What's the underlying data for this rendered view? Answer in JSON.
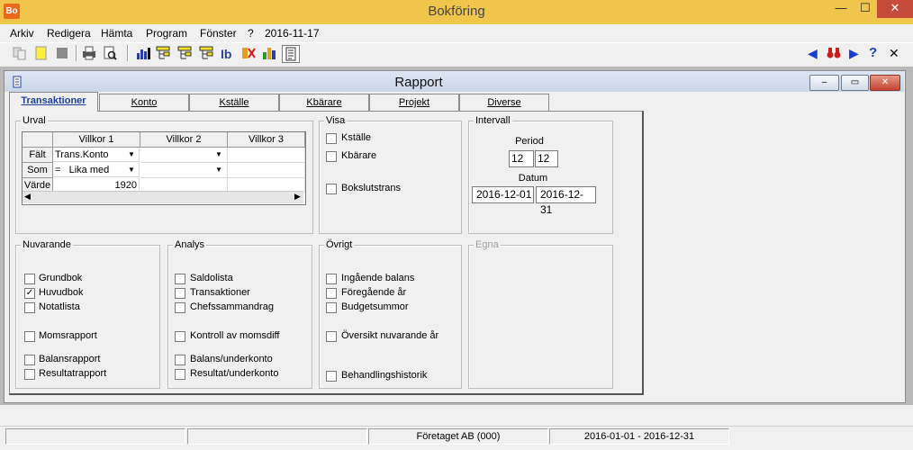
{
  "app": {
    "title": "Bokföring",
    "icon_text": "Bo"
  },
  "window_buttons": {
    "minimize": "—",
    "maximize": "☐",
    "close": "✕"
  },
  "menu": [
    "Arkiv",
    "Redigera",
    "Hämta",
    "Program",
    "Fönster",
    "?",
    "2016-11-17"
  ],
  "toolbar_icons": [
    "copy-icon",
    "new-icon",
    "stop-icon",
    "print-icon",
    "print-preview-icon",
    "chart-icon",
    "tree-icon",
    "tree-icon-2",
    "tree-icon-3",
    "ib-icon",
    "rx-icon",
    "bar-chart-icon",
    "report-icon"
  ],
  "nav_icons": {
    "prev": "◀",
    "find": "M",
    "next": "▶",
    "help": "?",
    "close": "✕"
  },
  "child": {
    "title": "Rapport",
    "minimize": "–",
    "maximize": "▭",
    "close": "✕"
  },
  "tabs": [
    {
      "label": "Transaktioner",
      "active": true
    },
    {
      "label": "Konto",
      "active": false
    },
    {
      "label": "Kställe",
      "active": false
    },
    {
      "label": "Kbärare",
      "active": false
    },
    {
      "label": "Projekt",
      "active": false
    },
    {
      "label": "Diverse",
      "active": false
    }
  ],
  "urval": {
    "label": "Urval",
    "columns": [
      "Villkor 1",
      "Villkor 2",
      "Villkor 3"
    ],
    "rows": [
      {
        "head": "Fält",
        "cells": [
          "Trans.Konto",
          "",
          ""
        ]
      },
      {
        "head": "Som",
        "cells": [
          "=   Lika med",
          "",
          ""
        ]
      },
      {
        "head": "Värde",
        "cells": [
          "1920",
          "",
          ""
        ]
      }
    ]
  },
  "visa": {
    "label": "Visa",
    "items": [
      {
        "label": "Kställe",
        "checked": false
      },
      {
        "label": "Kbärare",
        "checked": false
      },
      {
        "label": "Bokslutstrans",
        "checked": false
      }
    ]
  },
  "intervall": {
    "label": "Intervall",
    "period_label": "Period",
    "period_from": "12",
    "period_to": "12",
    "datum_label": "Datum",
    "datum_from": "2016-12-01",
    "datum_to": "2016-12-31"
  },
  "nuvarande": {
    "label": "Nuvarande",
    "items": [
      {
        "label": "Grundbok",
        "checked": false
      },
      {
        "label": "Huvudbok",
        "checked": true
      },
      {
        "label": "Notatlista",
        "checked": false
      },
      {
        "label": "Momsrapport",
        "checked": false
      },
      {
        "label": "Balansrapport",
        "checked": false
      },
      {
        "label": "Resultatrapport",
        "checked": false
      }
    ]
  },
  "analys": {
    "label": "Analys",
    "items": [
      {
        "label": "Saldolista",
        "checked": false
      },
      {
        "label": "Transaktioner",
        "checked": false
      },
      {
        "label": "Chefssammandrag",
        "checked": false
      },
      {
        "label": "Kontroll av momsdiff",
        "checked": false
      },
      {
        "label": "Balans/underkonto",
        "checked": false
      },
      {
        "label": "Resultat/underkonto",
        "checked": false
      }
    ]
  },
  "ovrigt": {
    "label": "Övrigt",
    "items": [
      {
        "label": "Ingående balans",
        "checked": false
      },
      {
        "label": "Föregående år",
        "checked": false
      },
      {
        "label": "Budgetsummor",
        "checked": false
      },
      {
        "label": "Översikt nuvarande år",
        "checked": false
      },
      {
        "label": "Behandlingshistorik",
        "checked": false
      }
    ]
  },
  "egna": {
    "label": "Egna"
  },
  "status": [
    "",
    "",
    "Företaget AB (000)",
    "2016-01-01 - 2016-12-31"
  ],
  "check_mark": "✓",
  "dropdown_arrow": "▼",
  "scroll": {
    "left": "◀",
    "right": "▶"
  }
}
